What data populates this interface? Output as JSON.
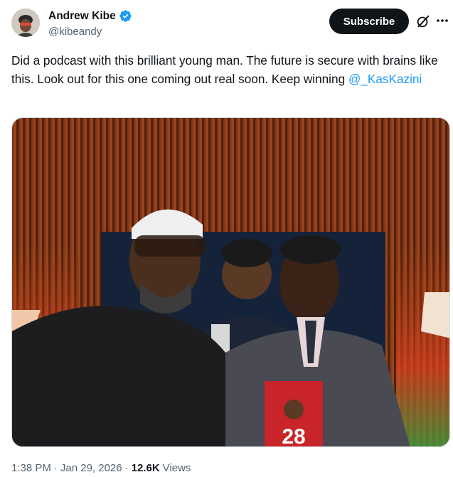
{
  "author": {
    "name": "Andrew Kibe",
    "handle": "@kibeandy",
    "verified_color": "#1d9bf0"
  },
  "actions": {
    "subscribe_label": "Subscribe",
    "grok_icon": "grok-icon",
    "more_icon": "more-horizontal-icon"
  },
  "tweet": {
    "text_before_mention": "Did a podcast with this brilliant young man. The future is secure with brains like this. Look out for this one coming out real soon. Keep winning ",
    "mention": "@_KasKazini",
    "photo_book_title": "28"
  },
  "meta": {
    "time": "1:38 PM",
    "dot1": "·",
    "date": "Jan 29, 2026",
    "dot2": "·",
    "views_count": "12.6K",
    "views_label": "Views"
  },
  "colors": {
    "text": "#0f1419",
    "secondary": "#536471",
    "link": "#1d9bf0",
    "button_bg": "#0f1419"
  }
}
